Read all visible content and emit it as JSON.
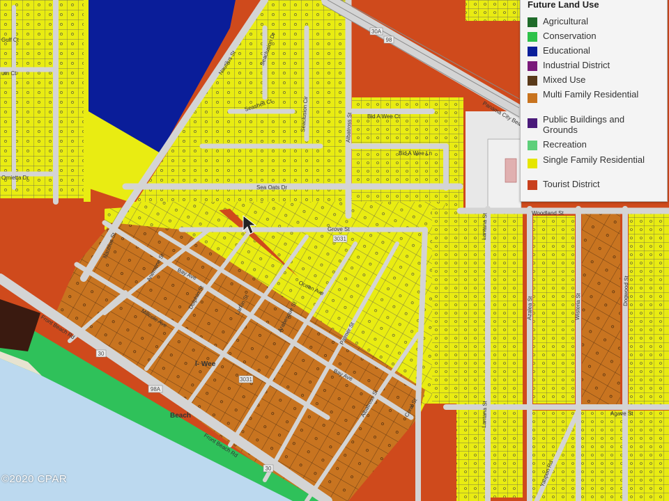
{
  "legend": {
    "title": "Future Land Use",
    "items": [
      {
        "label": "Agricultural",
        "color": "#1f6b2a"
      },
      {
        "label": "Conservation",
        "color": "#2ec24a"
      },
      {
        "label": "Educational",
        "color": "#0b1f9a"
      },
      {
        "label": "Industrial District",
        "color": "#7a1a7a"
      },
      {
        "label": "Mixed Use",
        "color": "#5a3a1a"
      },
      {
        "label": "Multi Family Residential",
        "color": "#c8731e"
      },
      {
        "label": "Public Buildings and Grounds",
        "color": "#4a1a7a"
      },
      {
        "label": "Recreation",
        "color": "#5ecf7a"
      },
      {
        "label": "Single Family Residential",
        "color": "#e6e600"
      },
      {
        "label": "Tourist District",
        "color": "#c8401e"
      }
    ]
  },
  "streets": {
    "nautilus_st_north": "Nautilus St",
    "nautilus_st_south": "Nautilus St",
    "seacliff_dr": "Seaclusion Dr",
    "seashell_ct": "Seashell Ct",
    "seacliff_cir": "Seaclusion Cir",
    "albatross_st_north": "Albatross St",
    "bid_a_wee_ct": "Bid A Wee Ct",
    "bid_a_wee_ln": "Bid A Wee Ln",
    "sea_oats_dr": "Sea Oats Dr",
    "panama_city_beach_pkwy": "Panama City Beach Pkwy",
    "woodland_st": "Woodland St",
    "lantana_st_north": "Lantana St",
    "lantana_st_south": "Lantana St",
    "azalea_st": "Azalea St",
    "wisteria_st": "Wisteria St",
    "dogwood_st": "Dogwood St",
    "agave_st": "Agave St",
    "yaupon_rd": "Yaupon Rd",
    "bay_ave_west": "Bay Ave",
    "bay_ave_east": "Bay Ave",
    "front_beach_rd_west": "Front Beach Rd",
    "front_beach_rd_east": "Front Beach Rd",
    "millcole_ave": "Millcole Ave",
    "anemone_st": "Anemone St",
    "dolphin_st": "Dolphin St",
    "larkin_st": "Larkin St",
    "arabesque_st": "Arabesque St",
    "ocean_ave": "Ocean Ave",
    "grove_st": "Grove St",
    "palmer_st": "Palmer St",
    "albatross_st_south": "Albatross St",
    "coral_st": "Coral St",
    "gulf_ct": "Gulf Ct",
    "bum_ct": "um Ct",
    "marietta_dr": "Ornietta Dr",
    "place_beach": "Beach",
    "place_wee": "l- Wee"
  },
  "routes": {
    "r30a": "30A",
    "r98": "98",
    "r3031": "3031",
    "r3032": "3031",
    "r30_west": "30",
    "r98a": "98A",
    "r30_east": "30"
  },
  "copyright": "©2020 CPAR"
}
